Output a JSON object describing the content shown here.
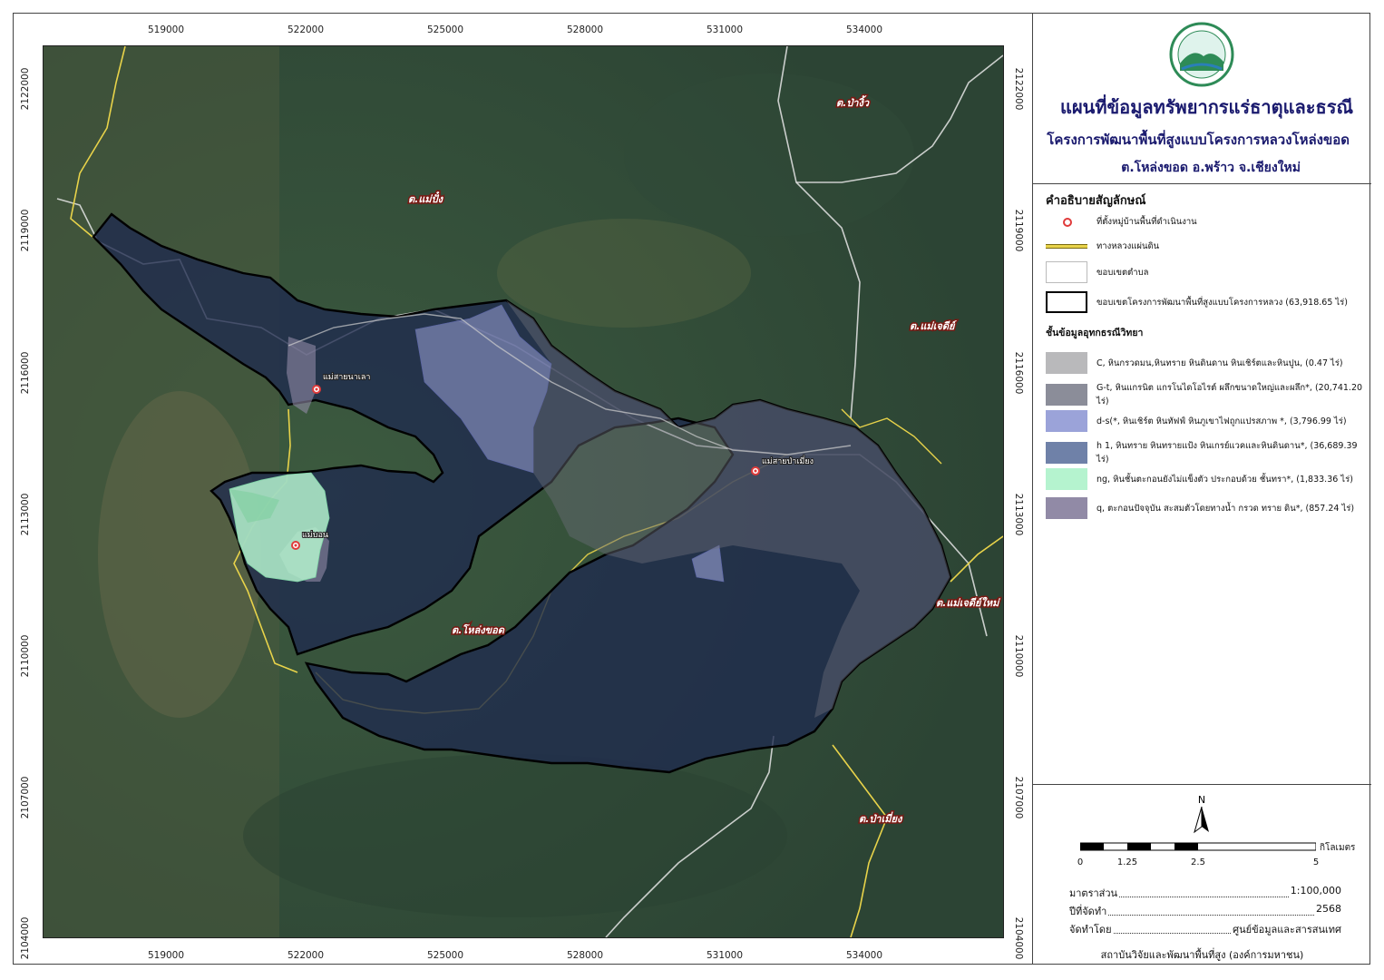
{
  "map": {
    "top_ticks": [
      "519000",
      "522000",
      "525000",
      "528000",
      "531000",
      "534000"
    ],
    "bottom_ticks": [
      "519000",
      "522000",
      "525000",
      "528000",
      "531000",
      "534000"
    ],
    "left_ticks": [
      "2122000",
      "2119000",
      "2116000",
      "2113000",
      "2110000",
      "2107000",
      "2104000"
    ],
    "right_ticks": [
      "2122000",
      "2119000",
      "2116000",
      "2113000",
      "2110000",
      "2107000",
      "2104000"
    ],
    "places": {
      "pa_ngio": "ต.ป่างิ้ว",
      "mae_pueng": "ต.แม่ปั๋ง",
      "mae_chedi": "ต.แม่เจดีย์",
      "lhong_khot": "ต.โหล่งขอด",
      "mae_chedi_mai": "ต.แม่เจดีย์ใหม่",
      "pa_miang": "ต.ป่าเมี่ยง"
    },
    "villages": {
      "mae_sai_na_lao": "แม่สายนาเลา",
      "mae_sai_pa_miang": "แม่สายป่าเมี่ยง",
      "mae_bon": "แม่บอน"
    }
  },
  "title": {
    "main": "แผนที่ข้อมูลทรัพยากรแร่ธาตุและธรณี",
    "sub": "โครงการพัฒนาพื้นที่สูงแบบโครงการหลวงโหล่งขอด",
    "location": "ต.โหล่งขอด อ.พร้าว จ.เชียงใหม่"
  },
  "legend": {
    "title": "คำอธิบายสัญลักษณ์",
    "village": "ที่ตั้งหมู่บ้านพื้นที่ดำเนินงาน",
    "highway": "ทางหลวงแผ่นดิน",
    "subdistrict": "ขอบเขตตำบล",
    "project": "ขอบเขตโครงการพัฒนาพื้นที่สูงแบบโครงการหลวง (63,918.65 ไร่)",
    "geo_title": "ชั้นข้อมูลอุทกธรณีวิทยา",
    "geo_items": [
      {
        "label": "C, หินกรวดมน,หินทราย หินดินดาน หินเชิร์ตและหินปูน, (0.47 ไร่)",
        "color": "#b9b9bb"
      },
      {
        "label": "G-t, หินแกรนิต แกรโนไดโอไรต์ ผลึกขนาดใหญ่และผลึก*, (20,741.20 ไร่)",
        "color": "#8b8d99"
      },
      {
        "label": "d-s(*, หินเชิร์ต หินทัฟฟ์ หินภูเขาไฟถูกแปรสภาพ *, (3,796.99 ไร่)",
        "color": "#9ba3d9"
      },
      {
        "label": "h 1, หินทราย หินทรายแป้ง หินเกรย์แวคและหินดินดาน*, (36,689.39 ไร่)",
        "color": "#6f81a8"
      },
      {
        "label": "ng, หินชั้นตะกอนยังไม่แข็งตัว ประกอบด้วย ชั้นทรา*, (1,833.36 ไร่)",
        "color": "#b5f3cf"
      },
      {
        "label": "q, ตะกอนปัจจุบัน สะสมตัวโดยทางน้ำ กรวด ทราย ดิน*, (857.24 ไร่)",
        "color": "#918aa6"
      }
    ]
  },
  "north_label": "N",
  "scale": {
    "labels": [
      "0",
      "1.25",
      "2.5",
      "5"
    ],
    "unit": "กิโลเมตร"
  },
  "info": {
    "scale_label": "มาตราส่วน",
    "scale_value": "1:100,000",
    "year_label": "ปีที่จัดทำ",
    "year_value": "2568",
    "by_label": "จัดทำโดย",
    "by_value": "ศูนย์ข้อมูลและสารสนเทศ",
    "org": "สถาบันวิจัยและพัฒนาพื้นที่สูง (องค์การมหาชน)"
  },
  "colors": {
    "imagery": "#33493a",
    "project_fill": "#1f2a4e",
    "road": "#e8d34a",
    "title": "#1a1a6e",
    "village_marker": "#e03a3a"
  }
}
